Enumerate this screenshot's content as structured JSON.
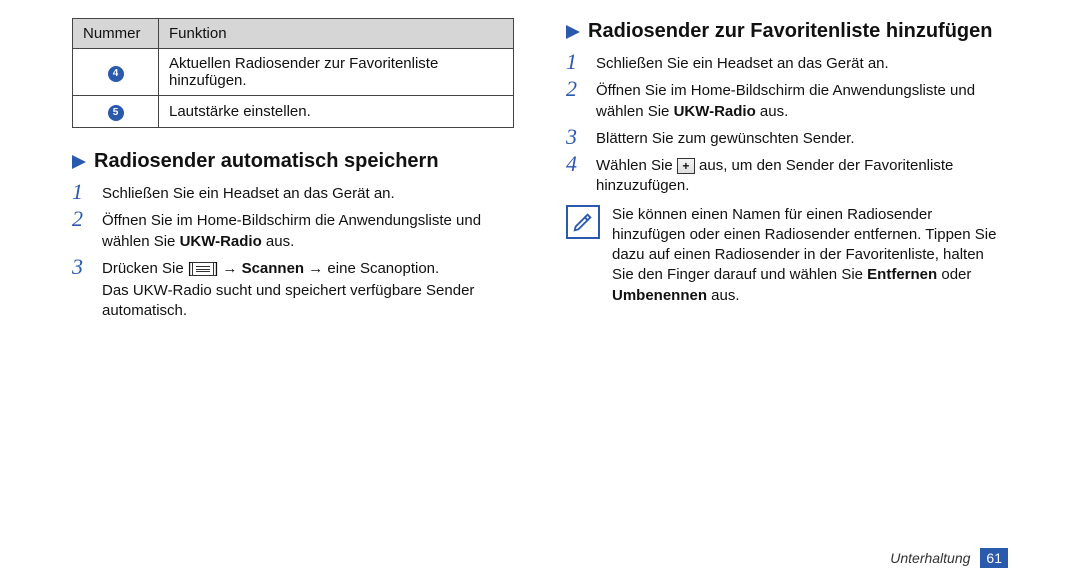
{
  "table": {
    "headers": {
      "num": "Nummer",
      "func": "Funktion"
    },
    "rows": [
      {
        "n": "4",
        "desc": "Aktuellen Radiosender zur Favoritenliste hinzufügen."
      },
      {
        "n": "5",
        "desc": "Lautstärke einstellen."
      }
    ]
  },
  "left": {
    "heading": "Radiosender automatisch speichern",
    "steps": {
      "s1": "Schließen Sie ein Headset an das Gerät an.",
      "s2a": "Öffnen Sie im Home-Bildschirm die Anwendungsliste und wählen Sie ",
      "s2b_bold": "UKW-Radio",
      "s2c": " aus.",
      "s3a": "Drücken Sie [",
      "s3b": "] → ",
      "s3c_bold": "Scannen",
      "s3d": " → eine Scanoption.",
      "s3e": "Das UKW-Radio sucht und speichert verfügbare Sender automatisch."
    }
  },
  "right": {
    "heading": "Radiosender zur Favoritenliste hinzufügen",
    "steps": {
      "s1": "Schließen Sie ein Headset an das Gerät an.",
      "s2a": "Öffnen Sie im Home-Bildschirm die Anwendungsliste und wählen Sie ",
      "s2b_bold": "UKW-Radio",
      "s2c": " aus.",
      "s3": "Blättern Sie zum gewünschten Sender.",
      "s4a": "Wählen Sie ",
      "s4b": " aus, um den Sender der Favoritenliste hinzuzufügen."
    },
    "note": {
      "t1": "Sie können einen Namen für einen Radiosender hinzufügen oder einen Radiosender entfernen. Tippen Sie dazu auf einen Radiosender in der Favoritenliste, halten Sie den Finger darauf und wählen Sie ",
      "b1": "Entfernen",
      "t2": " oder ",
      "b2": "Umbenennen",
      "t3": " aus."
    }
  },
  "footer": {
    "section": "Unterhaltung",
    "page": "61"
  }
}
